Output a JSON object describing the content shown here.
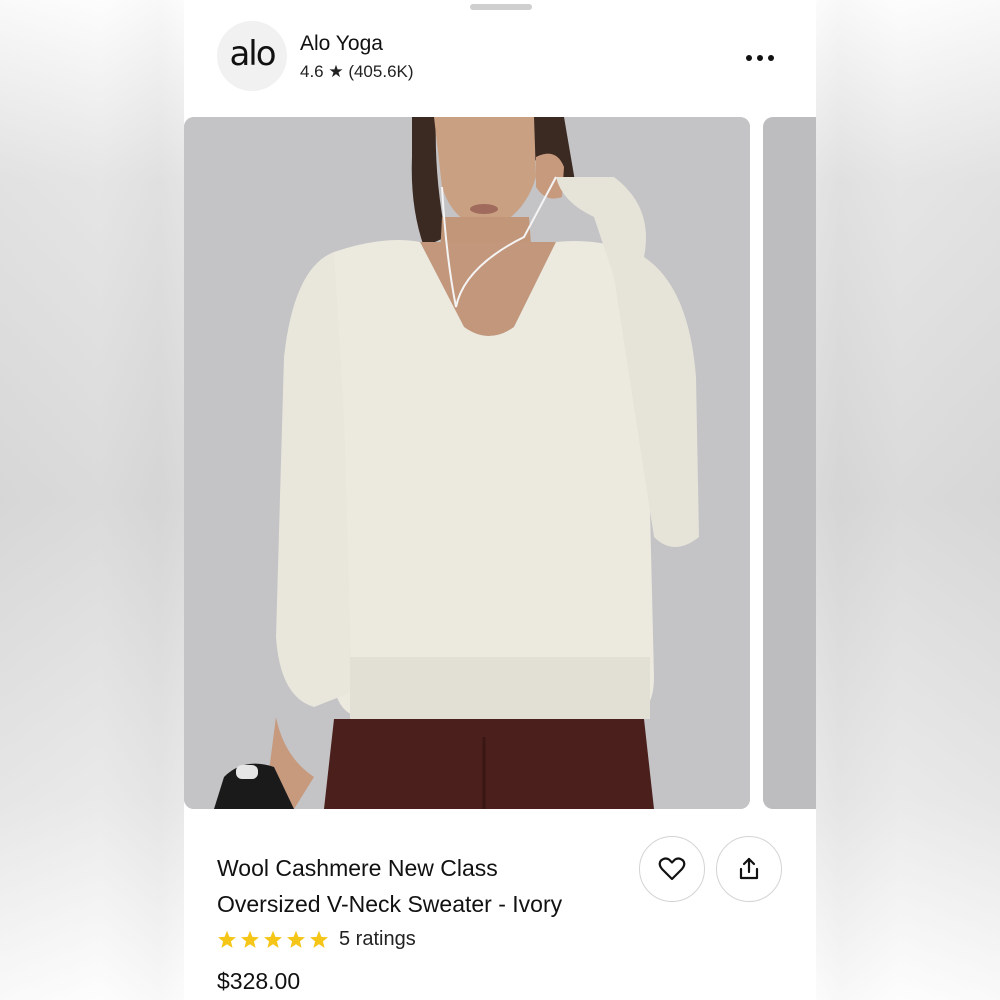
{
  "brand": {
    "logo_text": "alo",
    "name": "Alo Yoga",
    "rating": "4.6 ★ (405.6K)"
  },
  "product": {
    "title_line1": "Wool Cashmere New Class",
    "title_line2": "Oversized V-Neck Sweater - Ivory",
    "rating_stars": 5,
    "ratings_text": "5 ratings",
    "price": "$328.00"
  },
  "icons": {
    "more": "more-horizontal-icon",
    "favorite": "heart-icon",
    "share": "share-icon",
    "star": "star-icon"
  },
  "colors": {
    "star": "#f5c518",
    "text": "#111111",
    "image_background": "#c3c3c5",
    "sweater": "#ece9df",
    "leggings": "#4a1f1c"
  }
}
